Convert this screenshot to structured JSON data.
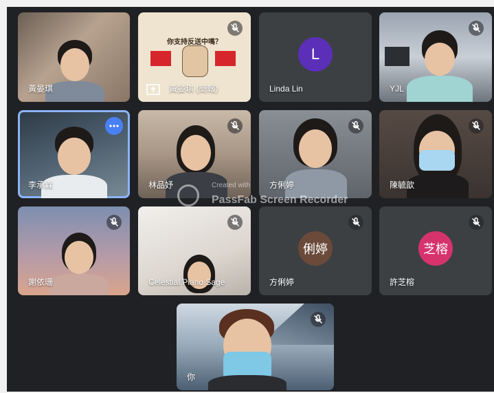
{
  "participants": [
    {
      "name": "黃晏琪",
      "muted": false
    },
    {
      "name": "黃晏琪 (簡報)",
      "muted": true,
      "poster_title": "你支持反送中嗎？"
    },
    {
      "name": "Linda Lin",
      "muted": false,
      "avatar_letter": "L",
      "avatar_color": "#5b2fb8"
    },
    {
      "name": "YJL",
      "muted": true
    },
    {
      "name": "李承霖",
      "muted": false,
      "active_speaker": true
    },
    {
      "name": "林品妤",
      "muted": true
    },
    {
      "name": "方俐婷",
      "muted": true
    },
    {
      "name": "陳毓歆",
      "muted": true
    },
    {
      "name": "謝依珊",
      "muted": true
    },
    {
      "name": "Celestial Piano Sage",
      "muted": true
    },
    {
      "name": "方俐婷",
      "muted": true,
      "avatar_letter": "俐婷",
      "avatar_color": "#6b4a3a"
    },
    {
      "name": "許芝榕",
      "muted": true,
      "avatar_letter": "芝榕",
      "avatar_color": "#d6336c"
    },
    {
      "name": "你",
      "muted": true
    }
  ],
  "watermark": {
    "created": "Created with",
    "product": "PassFab Screen Recorder"
  }
}
